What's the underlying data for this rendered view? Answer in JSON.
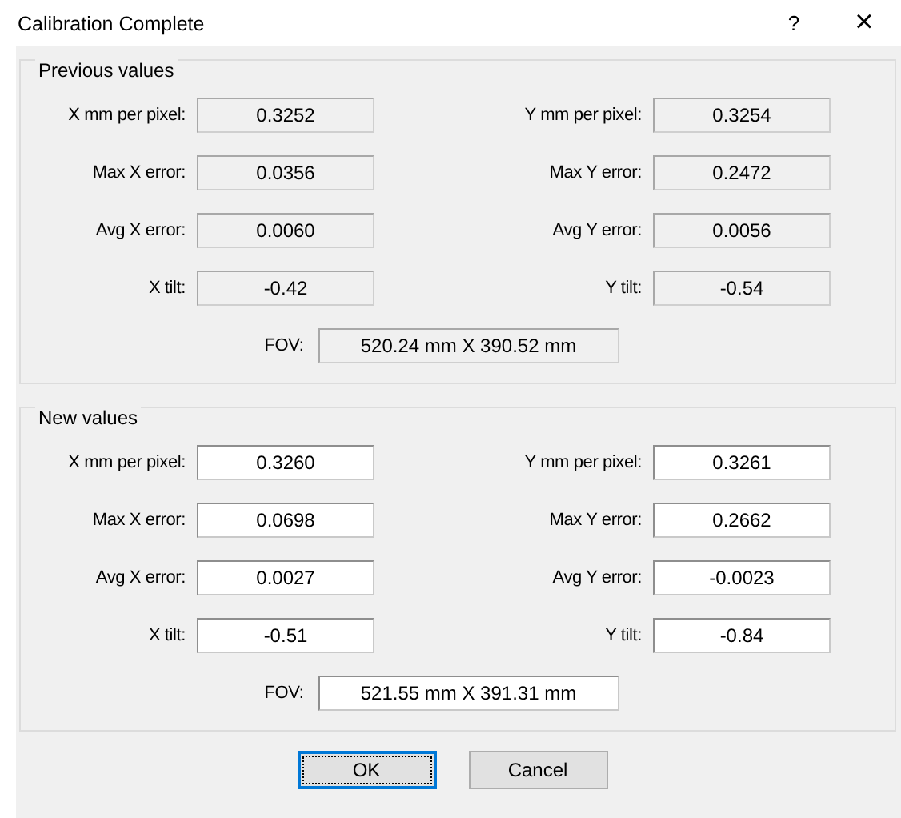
{
  "window": {
    "title": "Calibration Complete",
    "help": "?",
    "close": "×"
  },
  "groups": [
    {
      "title": "Previous values",
      "read_only": true,
      "fields": [
        {
          "label": "X mm per pixel:",
          "value": "0.3252"
        },
        {
          "label": "Y mm per pixel:",
          "value": "0.3254"
        },
        {
          "label": "Max X error:",
          "value": "0.0356"
        },
        {
          "label": "Max Y error:",
          "value": "0.2472"
        },
        {
          "label": "Avg X error:",
          "value": "0.0060"
        },
        {
          "label": "Avg Y error:",
          "value": "0.0056"
        },
        {
          "label": "X tilt:",
          "value": "-0.42"
        },
        {
          "label": "Y tilt:",
          "value": "-0.54"
        }
      ],
      "fov": {
        "label": "FOV:",
        "value": "520.24 mm X 390.52 mm"
      }
    },
    {
      "title": "New values",
      "read_only": false,
      "fields": [
        {
          "label": "X mm per pixel:",
          "value": "0.3260"
        },
        {
          "label": "Y mm per pixel:",
          "value": "0.3261"
        },
        {
          "label": "Max X error:",
          "value": "0.0698"
        },
        {
          "label": "Max Y error:",
          "value": "0.2662"
        },
        {
          "label": "Avg X error:",
          "value": "0.0027"
        },
        {
          "label": "Avg Y error:",
          "value": "-0.0023"
        },
        {
          "label": "X tilt:",
          "value": "-0.51"
        },
        {
          "label": "Y tilt:",
          "value": "-0.84"
        }
      ],
      "fov": {
        "label": "FOV:",
        "value": "521.55 mm X 391.31 mm"
      }
    }
  ],
  "buttons": [
    {
      "label": "OK",
      "default": true
    },
    {
      "label": "Cancel",
      "default": false
    }
  ]
}
